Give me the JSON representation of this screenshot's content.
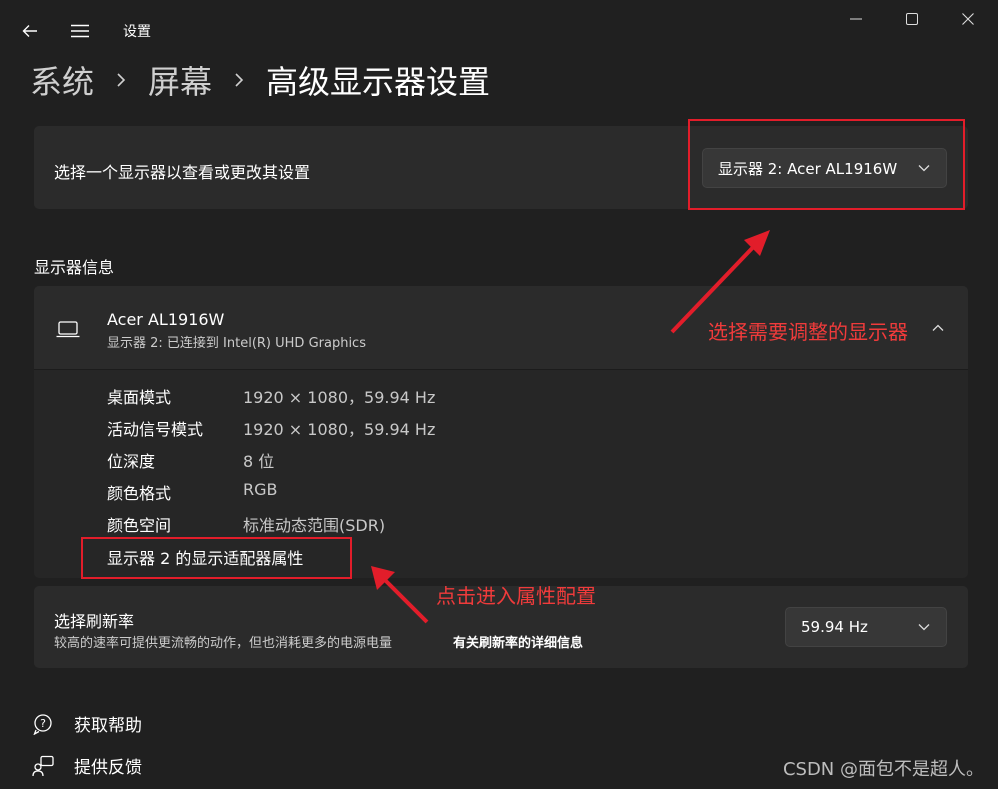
{
  "window": {
    "app_title": "设置",
    "back_icon": "back-arrow-icon",
    "menu_icon": "hamburger-menu-icon",
    "controls": [
      "minimize-icon",
      "maximize-icon",
      "close-icon"
    ]
  },
  "breadcrumb": {
    "items": [
      "系统",
      "屏幕"
    ],
    "current": "高级显示器设置"
  },
  "display_select": {
    "label": "选择一个显示器以查看或更改其设置",
    "selected": "显示器 2: Acer AL1916W"
  },
  "display_info": {
    "section_title": "显示器信息",
    "monitor_name": "Acer AL1916W",
    "monitor_subtitle": "显示器 2: 已连接到 Intel(R) UHD Graphics",
    "rows": [
      {
        "label": "桌面模式",
        "value": "1920 × 1080，59.94 Hz"
      },
      {
        "label": "活动信号模式",
        "value": "1920 × 1080，59.94 Hz"
      },
      {
        "label": "位深度",
        "value": "8 位"
      },
      {
        "label": "颜色格式",
        "value": "RGB"
      },
      {
        "label": "颜色空间",
        "value": "标准动态范围(SDR)"
      }
    ],
    "adapter_link": "显示器 2 的显示适配器属性"
  },
  "refresh": {
    "title": "选择刷新率",
    "description": "较高的速率可提供更流畅的动作，但也消耗更多的电源电量",
    "details_link": "有关刷新率的详细信息",
    "selected": "59.94 Hz"
  },
  "footer_links": {
    "help": "获取帮助",
    "feedback": "提供反馈"
  },
  "annotations": {
    "select_display": "选择需要调整的显示器",
    "click_properties": "点击进入属性配置",
    "color": "#e21d2a"
  },
  "watermark": "CSDN @面包不是超人。"
}
